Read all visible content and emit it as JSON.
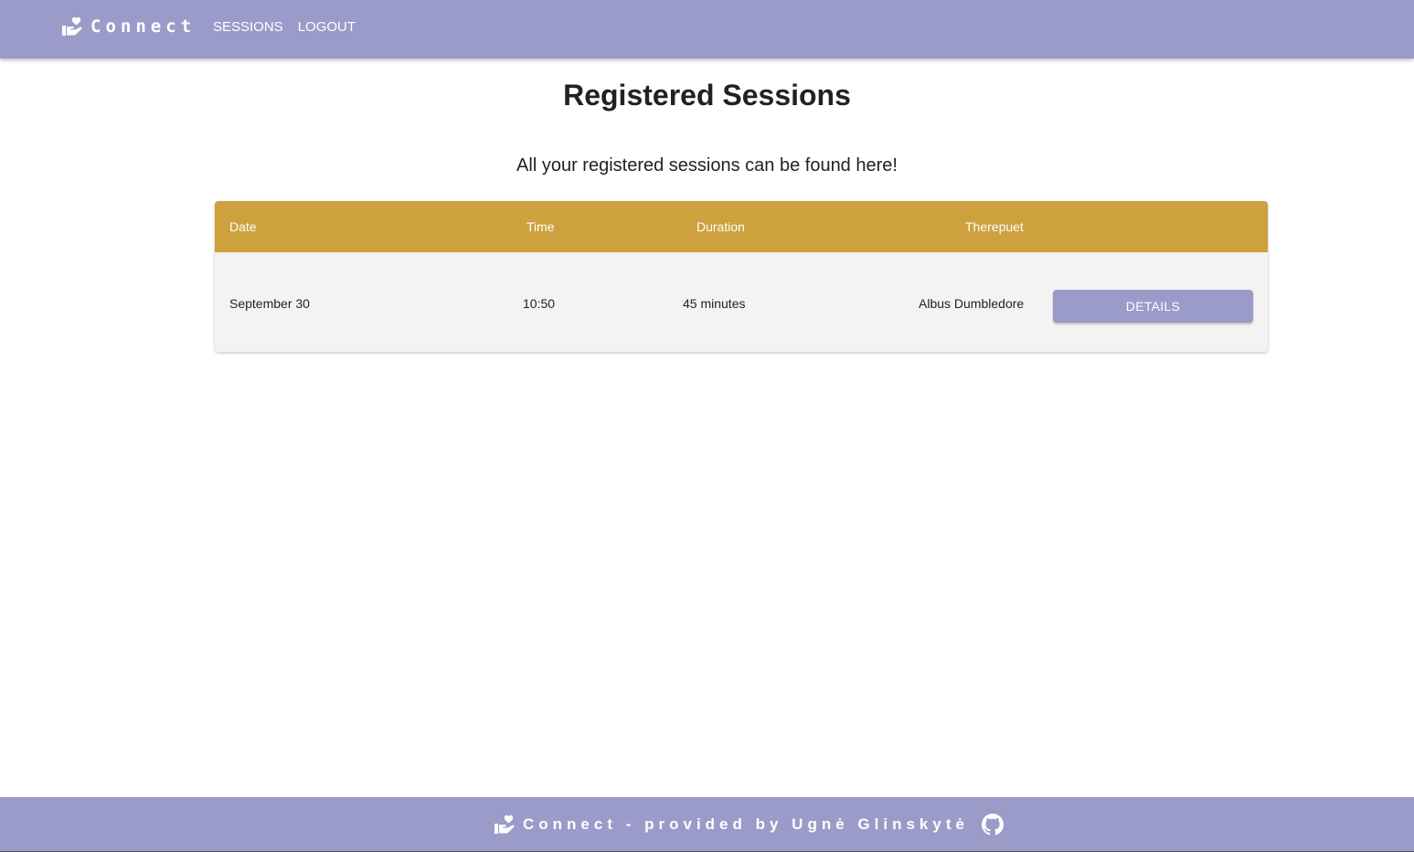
{
  "header": {
    "brand": "Connect",
    "brand_icon": "hand-heart-icon",
    "nav": {
      "sessions": "SESSIONS",
      "logout": "LOGOUT"
    }
  },
  "main": {
    "title": "Registered Sessions",
    "subtitle": "All your registered sessions can be found here!",
    "table": {
      "columns": [
        "Date",
        "Time",
        "Duration",
        "Therepuet"
      ],
      "rows": [
        {
          "date": "September 30",
          "time": "10:50",
          "duration": "45 minutes",
          "therapist": "Albus Dumbledore",
          "action_label": "DETAILS"
        }
      ]
    }
  },
  "footer": {
    "text": "Connect - provided by Ugnė Glinskytė",
    "icon": "hand-heart-icon",
    "link_icon": "github-icon"
  },
  "colors": {
    "primary": "#9b9bca",
    "table_header": "#cca13e",
    "row_background": "#f3f3f3",
    "text": "#222222"
  }
}
